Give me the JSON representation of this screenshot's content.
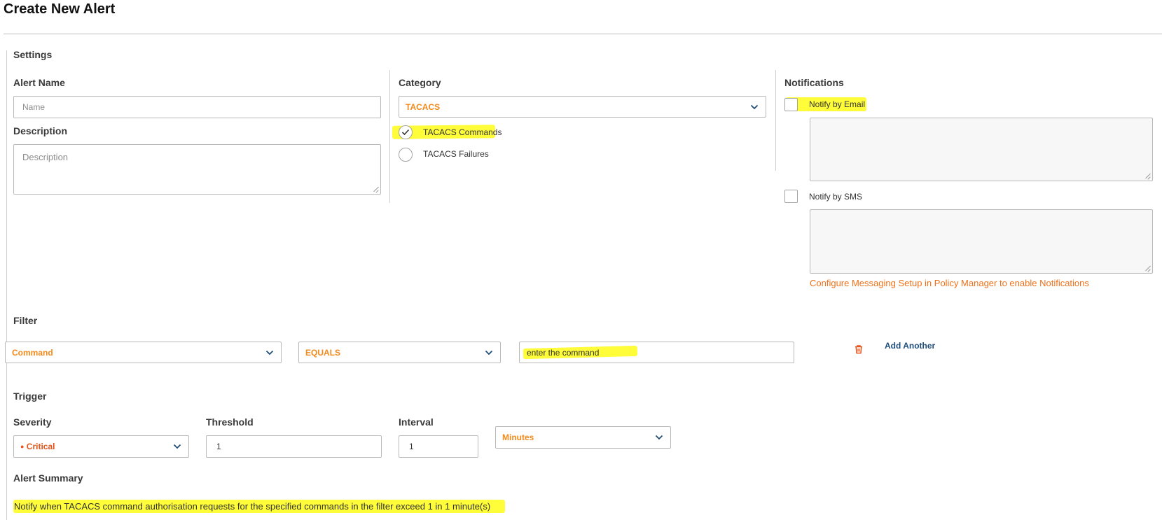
{
  "page": {
    "title": "Create New Alert"
  },
  "settings": {
    "title": "Settings",
    "alert_name": {
      "label": "Alert Name",
      "placeholder": "Name"
    },
    "description": {
      "label": "Description",
      "placeholder": "Description"
    }
  },
  "category": {
    "label": "Category",
    "selected": "TACACS",
    "options": [
      {
        "label": "TACACS Commands",
        "checked": true
      },
      {
        "label": "TACACS Failures",
        "checked": false
      }
    ]
  },
  "notifications": {
    "title": "Notifications",
    "email": {
      "label": "Notify by Email",
      "checked": false
    },
    "sms": {
      "label": "Notify by SMS",
      "checked": false
    },
    "configure_link": "Configure Messaging Setup in Policy Manager to enable Notifications"
  },
  "filter": {
    "title": "Filter",
    "field": "Command",
    "operator": "EQUALS",
    "value": "enter the command",
    "add_another": "Add Another"
  },
  "trigger": {
    "title": "Trigger",
    "severity": {
      "label": "Severity",
      "value": "Critical",
      "color": "#e8531a"
    },
    "threshold": {
      "label": "Threshold",
      "value": "1"
    },
    "interval": {
      "label": "Interval",
      "value": "1",
      "unit": "Minutes"
    }
  },
  "summary": {
    "title": "Alert Summary",
    "text": "Notify when TACACS command authorisation requests for the specified commands in the filter exceed 1 in 1 minute(s)"
  },
  "colors": {
    "accent_orange": "#f28a1c",
    "link_blue": "#1f4e7a",
    "highlight": "#fffc3a"
  }
}
